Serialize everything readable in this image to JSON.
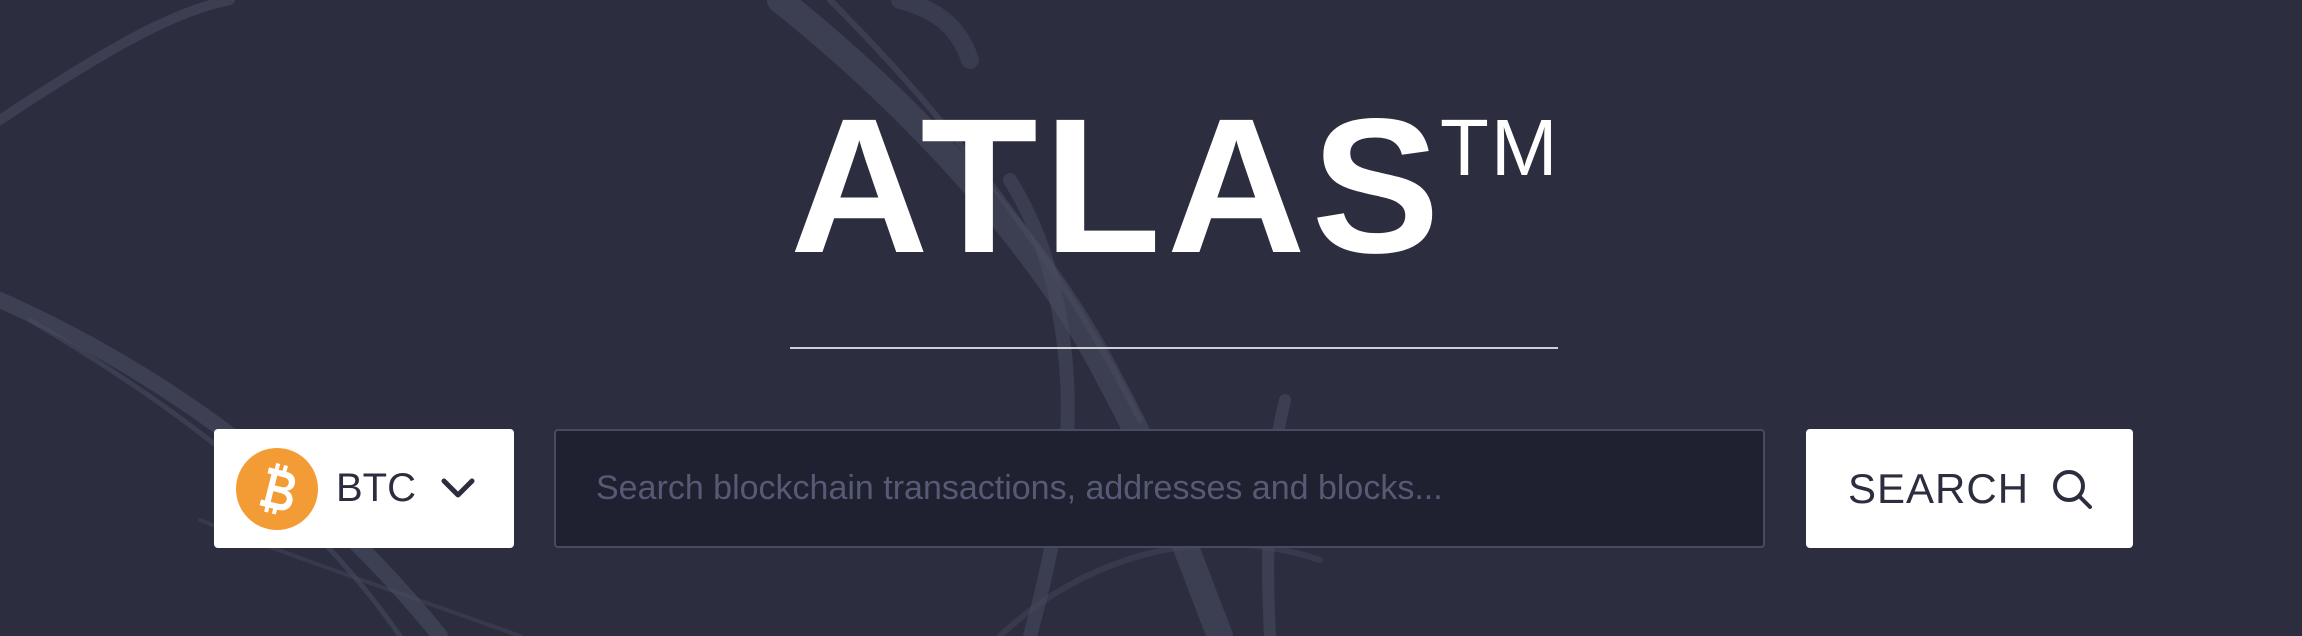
{
  "brand": {
    "name": "ATLAS",
    "trademark": "TM"
  },
  "currency_selector": {
    "selected": "BTC",
    "icon": "bitcoin-icon",
    "dropdown_icon": "chevron-down-icon"
  },
  "search": {
    "placeholder": "Search blockchain transactions, addresses and blocks...",
    "value": "",
    "button_label": "SEARCH",
    "button_icon": "search-icon"
  },
  "colors": {
    "background": "#2c2e40",
    "input_background": "#1f2030",
    "bitcoin_orange": "#f39c35",
    "text_white": "#ffffff"
  }
}
